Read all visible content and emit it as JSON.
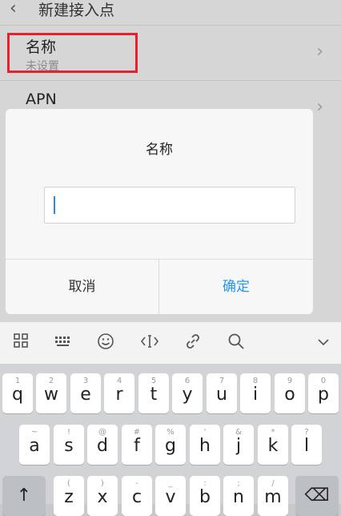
{
  "header": {
    "title": "新建接入点"
  },
  "rows": [
    {
      "label": "名称",
      "sub": "未设置"
    },
    {
      "label": "APN"
    }
  ],
  "dialog": {
    "title": "名称",
    "input_value": "",
    "cancel": "取消",
    "confirm": "确定"
  },
  "keyboard": {
    "row1": [
      {
        "hint": "1",
        "char": "q"
      },
      {
        "hint": "2",
        "char": "w"
      },
      {
        "hint": "3",
        "char": "e"
      },
      {
        "hint": "4",
        "char": "r"
      },
      {
        "hint": "5",
        "char": "t"
      },
      {
        "hint": "6",
        "char": "y"
      },
      {
        "hint": "7",
        "char": "u"
      },
      {
        "hint": "8",
        "char": "i"
      },
      {
        "hint": "9",
        "char": "o"
      },
      {
        "hint": "0",
        "char": "p"
      }
    ],
    "row2": [
      {
        "hint": "~",
        "char": "a"
      },
      {
        "hint": "!",
        "char": "s"
      },
      {
        "hint": "@",
        "char": "d"
      },
      {
        "hint": "#",
        "char": "f"
      },
      {
        "hint": "%",
        "char": "g"
      },
      {
        "hint": "'",
        "char": "h"
      },
      {
        "hint": "&",
        "char": "j"
      },
      {
        "hint": "*",
        "char": "k"
      },
      {
        "hint": "?",
        "char": "l"
      }
    ],
    "row3": [
      {
        "hint": "(",
        "char": "z"
      },
      {
        "hint": ")",
        "char": "x"
      },
      {
        "hint": "-",
        "char": "c"
      },
      {
        "hint": "_",
        "char": "v"
      },
      {
        "hint": ":",
        "char": "b"
      },
      {
        "hint": ";",
        "char": "n"
      },
      {
        "hint": "/",
        "char": "m"
      }
    ],
    "shift_glyph": "↑",
    "delete_glyph": "⌫"
  },
  "colors": {
    "accent": "#2196f3",
    "highlight": "#e8202a"
  }
}
